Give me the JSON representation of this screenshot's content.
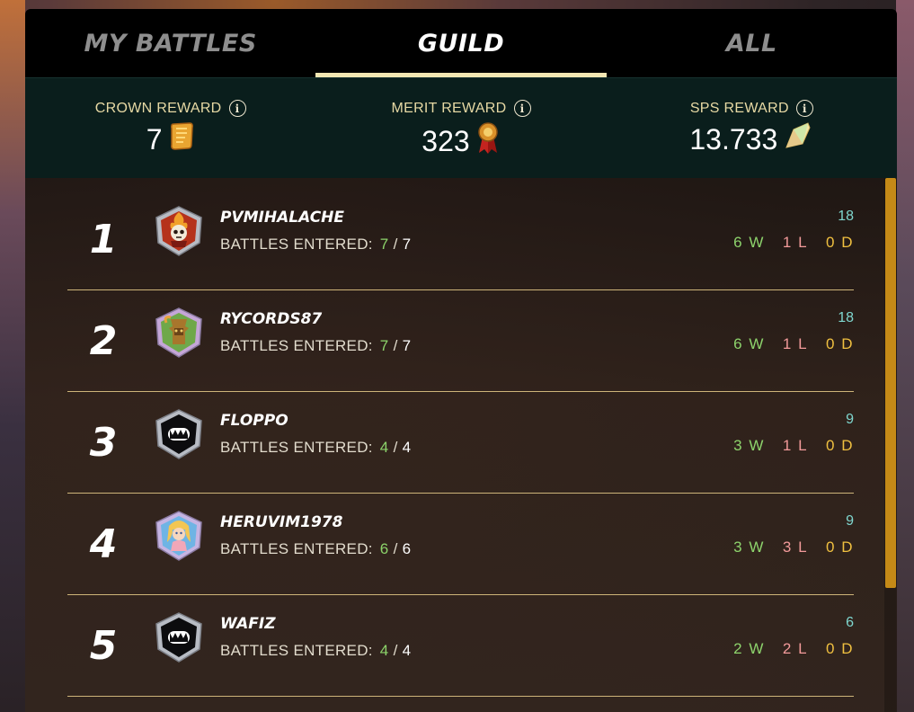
{
  "tabs": [
    {
      "label": "MY BATTLES",
      "active": false
    },
    {
      "label": "GUILD",
      "active": true
    },
    {
      "label": "ALL",
      "active": false
    }
  ],
  "rewards": {
    "crown": {
      "label": "CROWN REWARD",
      "value": "7",
      "icon": "crown-token-icon"
    },
    "merit": {
      "label": "MERIT REWARD",
      "value": "323",
      "icon": "merit-medal-icon"
    },
    "sps": {
      "label": "SPS REWARD",
      "value": "13.733",
      "icon": "sps-crystal-icon"
    }
  },
  "battles_label": "BATTLES ENTERED:",
  "players": [
    {
      "rank": "1",
      "name": "PVMIHALACHE",
      "entered": "7",
      "total": "7",
      "score": "18",
      "wins": "6 W",
      "losses": "1 L",
      "draws": "0 D",
      "avatar": "fire-skull-avatar-icon"
    },
    {
      "rank": "2",
      "name": "RYCORDS87",
      "entered": "7",
      "total": "7",
      "score": "18",
      "wins": "6 W",
      "losses": "1 L",
      "draws": "0 D",
      "avatar": "tree-spirit-avatar-icon"
    },
    {
      "rank": "3",
      "name": "FLOPPO",
      "entered": "4",
      "total": "4",
      "score": "9",
      "wins": "3 W",
      "losses": "1 L",
      "draws": "0 D",
      "avatar": "shadow-monster-avatar-icon"
    },
    {
      "rank": "4",
      "name": "HERUVIM1978",
      "entered": "6",
      "total": "6",
      "score": "9",
      "wins": "3 W",
      "losses": "3 L",
      "draws": "0 D",
      "avatar": "angel-girl-avatar-icon"
    },
    {
      "rank": "5",
      "name": "WAFIZ",
      "entered": "4",
      "total": "4",
      "score": "6",
      "wins": "2 W",
      "losses": "2 L",
      "draws": "0 D",
      "avatar": "shadow-monster-avatar-icon"
    }
  ],
  "colors": {
    "accent": "#f3e7b3",
    "reward_label": "#e7d9a4",
    "win": "#8dd36c",
    "loss": "#f29a9a",
    "draw": "#f0c040",
    "score": "#7fd7cf",
    "scrollbar": "#c58a17"
  }
}
